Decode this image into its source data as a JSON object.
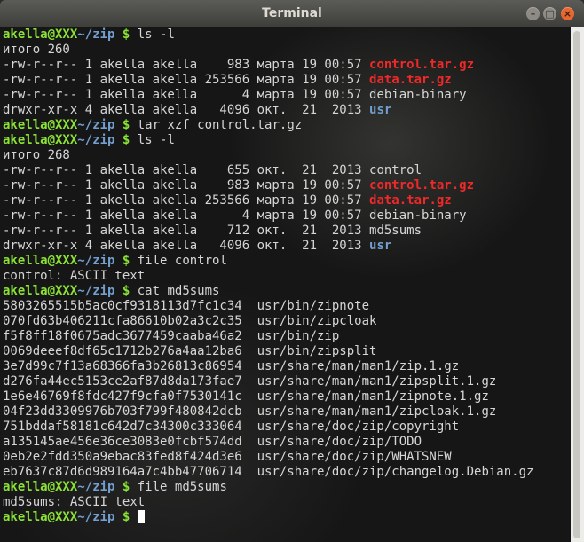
{
  "window": {
    "title": "Terminal"
  },
  "prompt": {
    "user": "akella@XXX",
    "path": "~/zip",
    "symbol": " $ "
  },
  "colors": {
    "prompt": "#8ae234",
    "path": "#729fcf",
    "archive": "#ef2929",
    "directory": "#729fcf",
    "text": "#d6d6d6"
  },
  "lines": [
    {
      "t": "prompt",
      "cmd": "ls -l"
    },
    {
      "t": "text",
      "text": "итого 260"
    },
    {
      "t": "file",
      "pre": "-rw-r--r-- 1 akella akella    983 марта 19 00:57 ",
      "name": "control.tar.gz",
      "kind": "red"
    },
    {
      "t": "file",
      "pre": "-rw-r--r-- 1 akella akella 253566 марта 19 00:57 ",
      "name": "data.tar.gz",
      "kind": "red"
    },
    {
      "t": "file",
      "pre": "-rw-r--r-- 1 akella akella      4 марта 19 00:57 ",
      "name": "debian-binary",
      "kind": ""
    },
    {
      "t": "file",
      "pre": "drwxr-xr-x 4 akella akella   4096 окт.  21  2013 ",
      "name": "usr",
      "kind": "blue"
    },
    {
      "t": "prompt",
      "cmd": "tar xzf control.tar.gz"
    },
    {
      "t": "prompt",
      "cmd": "ls -l"
    },
    {
      "t": "text",
      "text": "итого 268"
    },
    {
      "t": "file",
      "pre": "-rw-r--r-- 1 akella akella    655 окт.  21  2013 ",
      "name": "control",
      "kind": ""
    },
    {
      "t": "file",
      "pre": "-rw-r--r-- 1 akella akella    983 марта 19 00:57 ",
      "name": "control.tar.gz",
      "kind": "red"
    },
    {
      "t": "file",
      "pre": "-rw-r--r-- 1 akella akella 253566 марта 19 00:57 ",
      "name": "data.tar.gz",
      "kind": "red"
    },
    {
      "t": "file",
      "pre": "-rw-r--r-- 1 akella akella      4 марта 19 00:57 ",
      "name": "debian-binary",
      "kind": ""
    },
    {
      "t": "file",
      "pre": "-rw-r--r-- 1 akella akella    712 окт.  21  2013 ",
      "name": "md5sums",
      "kind": ""
    },
    {
      "t": "file",
      "pre": "drwxr-xr-x 4 akella akella   4096 окт.  21  2013 ",
      "name": "usr",
      "kind": "blue"
    },
    {
      "t": "prompt",
      "cmd": "file control"
    },
    {
      "t": "text",
      "text": "control: ASCII text"
    },
    {
      "t": "prompt",
      "cmd": "cat md5sums"
    },
    {
      "t": "text",
      "text": "5803265515b5ac0cf9318113d7fc1c34  usr/bin/zipnote"
    },
    {
      "t": "text",
      "text": "070fd63b406211cfa86610b02a3c2c35  usr/bin/zipcloak"
    },
    {
      "t": "text",
      "text": "f5f8ff18f0675adc3677459caaba46a2  usr/bin/zip"
    },
    {
      "t": "text",
      "text": "0069deeef8df65c1712b276a4aa12ba6  usr/bin/zipsplit"
    },
    {
      "t": "text",
      "text": "3e7d99c7f13a68366fa3b26813c86954  usr/share/man/man1/zip.1.gz"
    },
    {
      "t": "text",
      "text": "d276fa44ec5153ce2af87d8da173fae7  usr/share/man/man1/zipsplit.1.gz"
    },
    {
      "t": "text",
      "text": "1e6e46769f8fdc427f9cfa0f7530141c  usr/share/man/man1/zipnote.1.gz"
    },
    {
      "t": "text",
      "text": "04f23dd3309976b703f799f480842dcb  usr/share/man/man1/zipcloak.1.gz"
    },
    {
      "t": "text",
      "text": "751bddaf58181c642d7c34300c333064  usr/share/doc/zip/copyright"
    },
    {
      "t": "text",
      "text": "a135145ae456e36ce3083e0fcbf574dd  usr/share/doc/zip/TODO"
    },
    {
      "t": "text",
      "text": "0eb2e2fdd350a9ebac83fed8f424d3e6  usr/share/doc/zip/WHATSNEW"
    },
    {
      "t": "text",
      "text": "eb7637c87d6d989164a7c4bb47706714  usr/share/doc/zip/changelog.Debian.gz"
    },
    {
      "t": "prompt",
      "cmd": "file md5sums"
    },
    {
      "t": "text",
      "text": "md5sums: ASCII text"
    },
    {
      "t": "prompt",
      "cmd": "",
      "cursor": true
    }
  ]
}
